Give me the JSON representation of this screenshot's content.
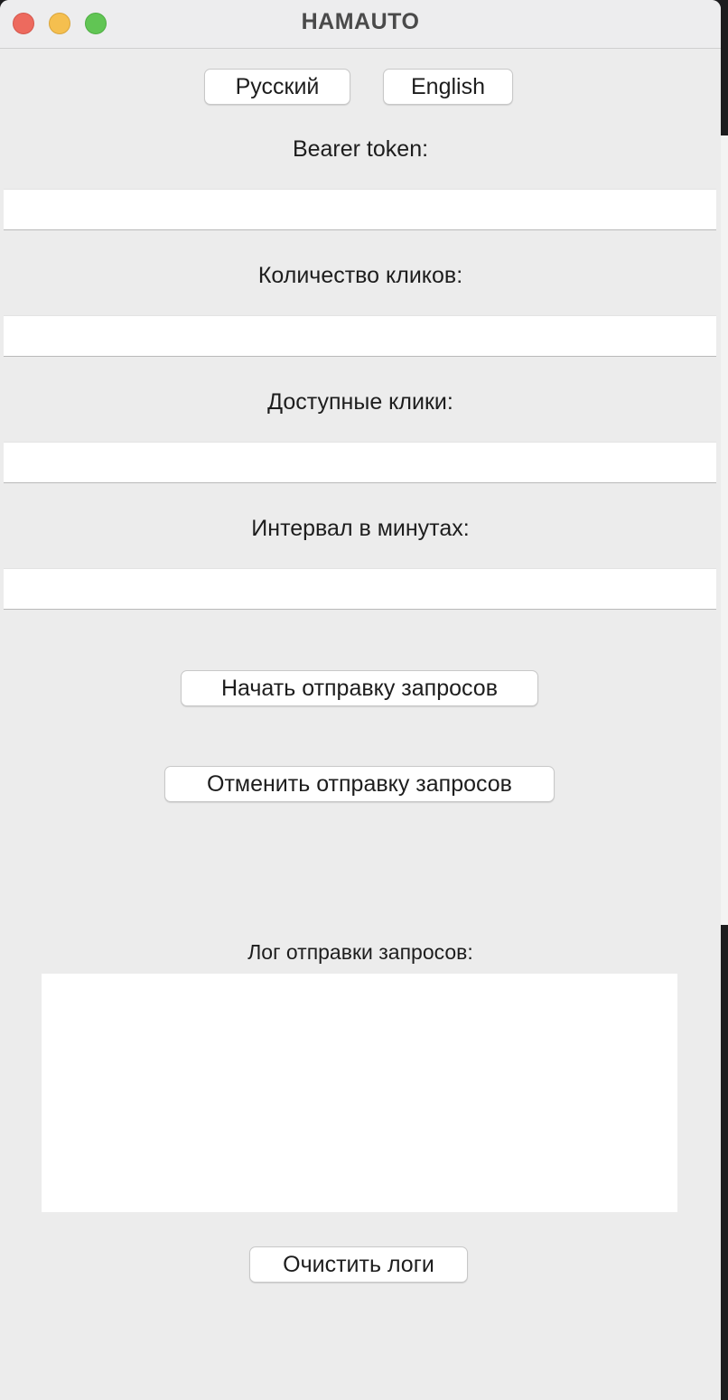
{
  "window": {
    "title": "HAMAUTO"
  },
  "language": {
    "russian_label": "Русский",
    "english_label": "English"
  },
  "fields": {
    "bearer_token": {
      "label": "Bearer token:",
      "value": ""
    },
    "click_count": {
      "label": "Количество кликов:",
      "value": ""
    },
    "available_clicks": {
      "label": "Доступные клики:",
      "value": ""
    },
    "interval_minutes": {
      "label": "Интервал в минутах:",
      "value": ""
    }
  },
  "actions": {
    "start_label": "Начать отправку запросов",
    "cancel_label": "Отменить отправку запросов"
  },
  "log": {
    "label": "Лог отправки запросов:",
    "content": "",
    "clear_label": "Очистить логи"
  },
  "colors": {
    "close": "#ed6a5e",
    "minimize": "#f5bf4f",
    "zoom": "#61c554",
    "window_bg": "#ececec"
  }
}
